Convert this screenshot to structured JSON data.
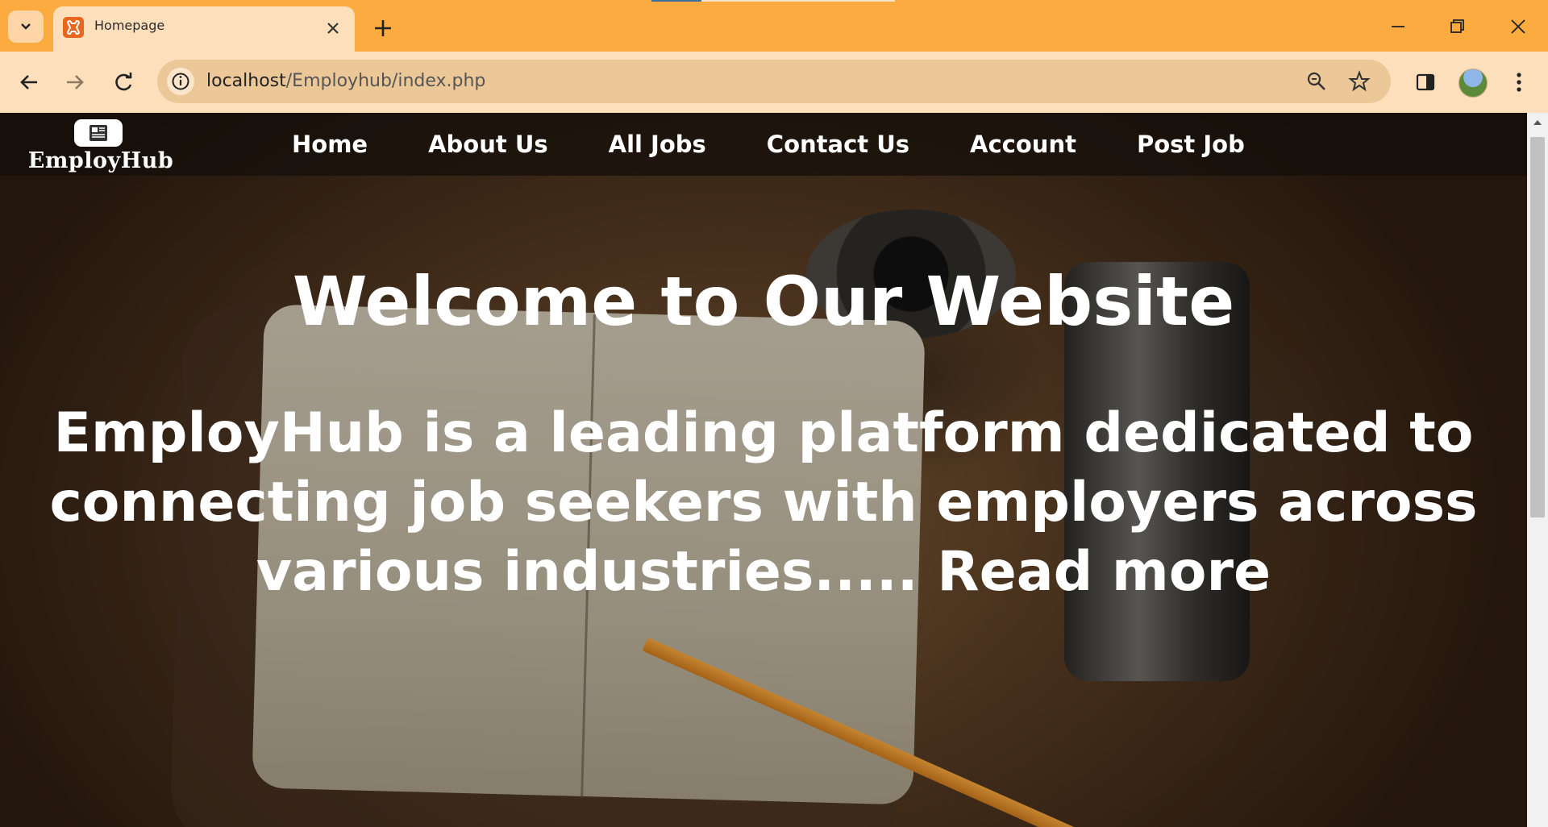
{
  "browser": {
    "tab_title": "Homepage",
    "url_host": "localhost",
    "url_path": "/Employhub/index.php"
  },
  "site": {
    "logo_text": "EmployHub",
    "nav": [
      {
        "label": "Home"
      },
      {
        "label": "About Us"
      },
      {
        "label": "All Jobs"
      },
      {
        "label": "Contact Us"
      },
      {
        "label": "Account"
      },
      {
        "label": "Post Job"
      }
    ]
  },
  "hero": {
    "title": "Welcome to Our Website",
    "text": "EmployHub is a leading platform dedicated to connecting job seekers with employers across various industries.....",
    "link": "Read more"
  },
  "colors": {
    "chrome_bar": "#fbab3f",
    "active_tab": "#fde0bb",
    "omnibox": "#ecc899",
    "favicon": "#e8661d"
  },
  "icons": [
    "chevron-down-icon",
    "xampp-icon",
    "close-icon",
    "plus-icon",
    "minimize-icon",
    "restore-icon",
    "back-arrow-icon",
    "forward-arrow-icon",
    "reload-icon",
    "info-icon",
    "zoom-icon",
    "star-icon",
    "side-panel-icon",
    "menu-dots-icon",
    "newspaper-icon"
  ]
}
